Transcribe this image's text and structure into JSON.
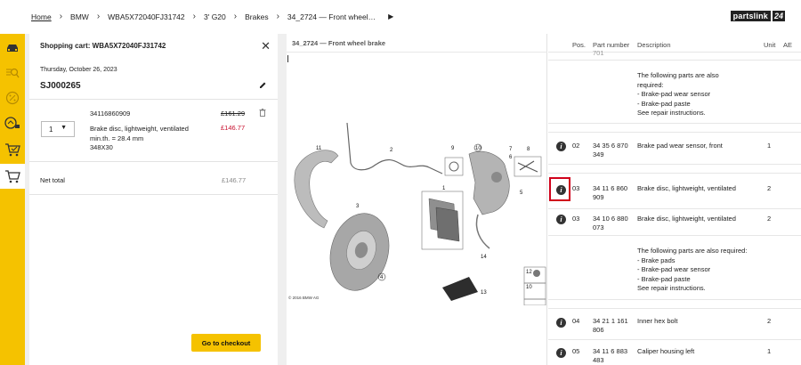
{
  "breadcrumb": [
    "Home",
    "BMW",
    "WBA5X72040FJ31742",
    "3' G20",
    "Brakes",
    "34_2724 — Front wheel…"
  ],
  "logo": {
    "text": "partslink",
    "num": "24"
  },
  "sidebar": {
    "icons": [
      "car-icon",
      "search-parts-icon",
      "percent-icon",
      "repair-icon",
      "cart-check-icon",
      "cart-icon"
    ],
    "active": "cart-icon"
  },
  "cart": {
    "title": "Shopping cart: WBA5X72040FJ31742",
    "date": "Thursday, October 26, 2023",
    "order": "SJ000265",
    "item": {
      "qty": "1",
      "part_number": "34116860909",
      "desc_line1": "Brake disc, lightweight, ventilated",
      "desc_line2": "min.th. = 28.4 mm",
      "desc_line3": "348X30",
      "price_old": "£161.29",
      "price_new": "£146.77"
    },
    "net_label": "Net total",
    "net_value": "£146.77",
    "checkout_label": "Go to checkout"
  },
  "diagram": {
    "title": "34_2724 — Front wheel brake",
    "copyright": "© 2016 BMW AG",
    "ref": "477700",
    "callouts": [
      "11",
      "2",
      "9",
      "10",
      "7",
      "6",
      "8",
      "3",
      "1",
      "5",
      "14",
      "12",
      "10",
      "4",
      "13"
    ]
  },
  "parts": {
    "headers": {
      "pos": "Pos.",
      "part": "Part number",
      "desc": "Description",
      "unit": "Unit",
      "ae": "AE"
    },
    "top_partial": "701",
    "note1": [
      "The following parts are also",
      "required:",
      "- Brake-pad wear sensor",
      "- Brake-pad paste",
      "See repair instructions."
    ],
    "rows": [
      {
        "pos": "02",
        "part1": "34 35 6 870",
        "part2": "349",
        "desc": "Brake pad wear sensor, front",
        "unit": "1"
      },
      {
        "pos": "03",
        "part1": "34 11 6 860",
        "part2": "909",
        "desc": "Brake disc, lightweight, ventilated",
        "unit": "2"
      },
      {
        "pos": "03",
        "part1": "34 10 6 880",
        "part2": "073",
        "desc": "Brake disc, lightweight, ventilated",
        "unit": "2"
      },
      {
        "pos": "04",
        "part1": "34 21 1 161",
        "part2": "806",
        "desc": "Inner hex bolt",
        "unit": "2"
      },
      {
        "pos": "05",
        "part1": "34 11 6 883",
        "part2": "483",
        "desc": "Caliper housing left",
        "unit": "1"
      }
    ],
    "note2": [
      "The following parts are also required:",
      "- Brake pads",
      "- Brake-pad wear sensor",
      "- Brake-pad paste",
      "See repair instructions."
    ]
  },
  "colors": {
    "accent": "#f5c200",
    "price_red": "#c8102e",
    "highlight": "#d0021b"
  }
}
